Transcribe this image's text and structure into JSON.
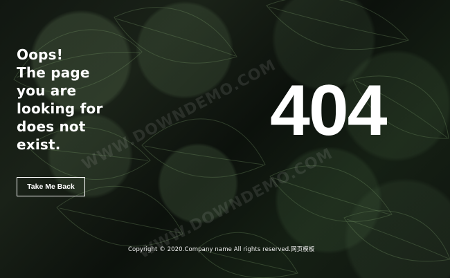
{
  "error": {
    "heading": "Oops!\nThe page\nyou are\nlooking for\ndoes not\nexist.",
    "code": "404",
    "back_button": "Take Me Back"
  },
  "footer": {
    "copyright": "Copyright © 2020.Company name All rights reserved.网页模板"
  },
  "watermarks": [
    "WWW.DOWNDEMO.COM",
    "WWW.DOWNDEMO.COM"
  ],
  "colors": {
    "text": "#ffffff",
    "background": "#0f140f",
    "leaf": "#55704d"
  }
}
